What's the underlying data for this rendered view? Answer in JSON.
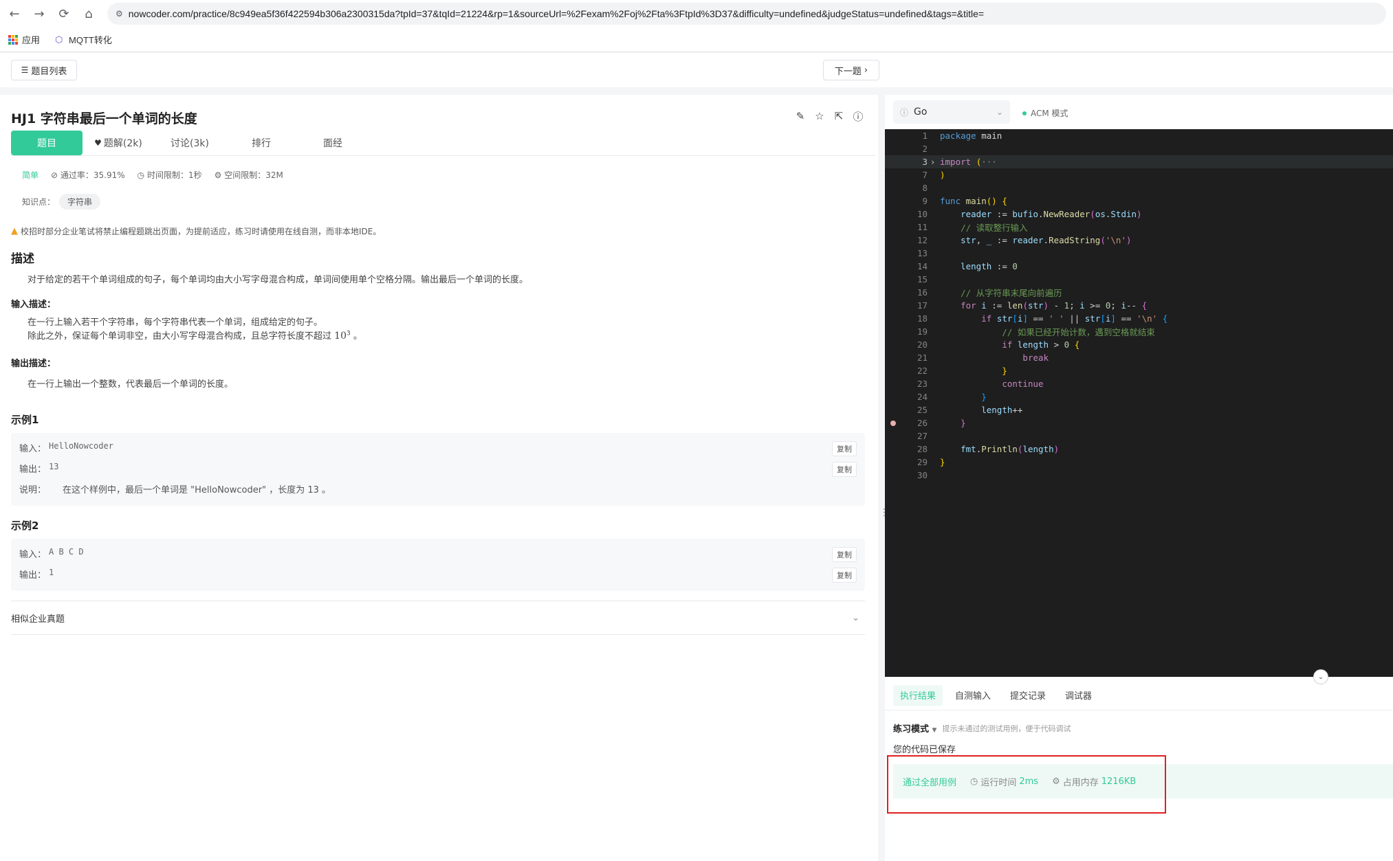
{
  "browser": {
    "url": "nowcoder.com/practice/8c949ea5f36f422594b306a2300315da?tpId=37&tqId=21224&rp=1&sourceUrl=%2Fexam%2Foj%2Fta%3FtpId%3D37&difficulty=undefined&judgeStatus=undefined&tags=&title=",
    "bookmarks": [
      "应用",
      "MQTT转化"
    ]
  },
  "topbar": {
    "list_label": "题目列表",
    "next_label": "下一题"
  },
  "problem": {
    "title": "HJ1  字符串最后一个单词的长度",
    "tabs": [
      "题目",
      "题解(2k)",
      "讨论(3k)",
      "排行",
      "面经"
    ],
    "difficulty": "简单",
    "pass_rate": "通过率：35.91%",
    "time_limit": "时间限制：1秒",
    "space_limit": "空间限制：32M",
    "knowledge_label": "知识点：",
    "knowledge_tag": "字符串",
    "warning": "校招时部分企业笔试将禁止编程题跳出页面，为提前适应，练习时请使用在线自测，而非本地IDE。",
    "desc_title": "描述",
    "desc_text": "对于给定的若干个单词组成的句子，每个单词均由大小写字母混合构成，单词间使用单个空格分隔。输出最后一个单词的长度。",
    "input_title": "输入描述：",
    "input_line1": "在一行上输入若干个字符串，每个字符串代表一个单词，组成给定的句子。",
    "input_line2": "除此之外，保证每个单词非空，由大小写字母混合构成，且总字符长度不超过",
    "input_line2_math": "10",
    "input_line2_sup": "3",
    "input_line2_end": "。",
    "output_title": "输出描述：",
    "output_text": "在一行上输出一个整数，代表最后一个单词的长度。",
    "example1_title": "示例1",
    "example1": {
      "input_label": "输入：",
      "input": "HelloNowcoder",
      "output_label": "输出：",
      "output": "13",
      "explain_label": "说明：",
      "explain": "在这个样例中，最后一个单词是 \"HelloNowcoder\" ，长度为 13 。"
    },
    "example2_title": "示例2",
    "example2": {
      "input_label": "输入：",
      "input": "A B C D",
      "output_label": "输出：",
      "output": "1"
    },
    "copy_label": "复制",
    "similar_label": "相似企业真题"
  },
  "editor": {
    "language": "Go",
    "mode": "ACM 模式"
  },
  "result": {
    "tabs": [
      "执行结果",
      "自测输入",
      "提交记录",
      "调试器"
    ],
    "practice_mode": "练习模式",
    "practice_hint": "提示未通过的测试用例，便于代码调试",
    "saved": "您的代码已保存",
    "pass_label": "通过全部用例",
    "runtime_label": "运行时间",
    "runtime_value": "2ms",
    "memory_label": "占用内存",
    "memory_value": "1216KB"
  },
  "colors": {
    "accent": "#32ca99",
    "highlight_frame": "#e02020",
    "editor_bg": "#1e1e1e"
  }
}
